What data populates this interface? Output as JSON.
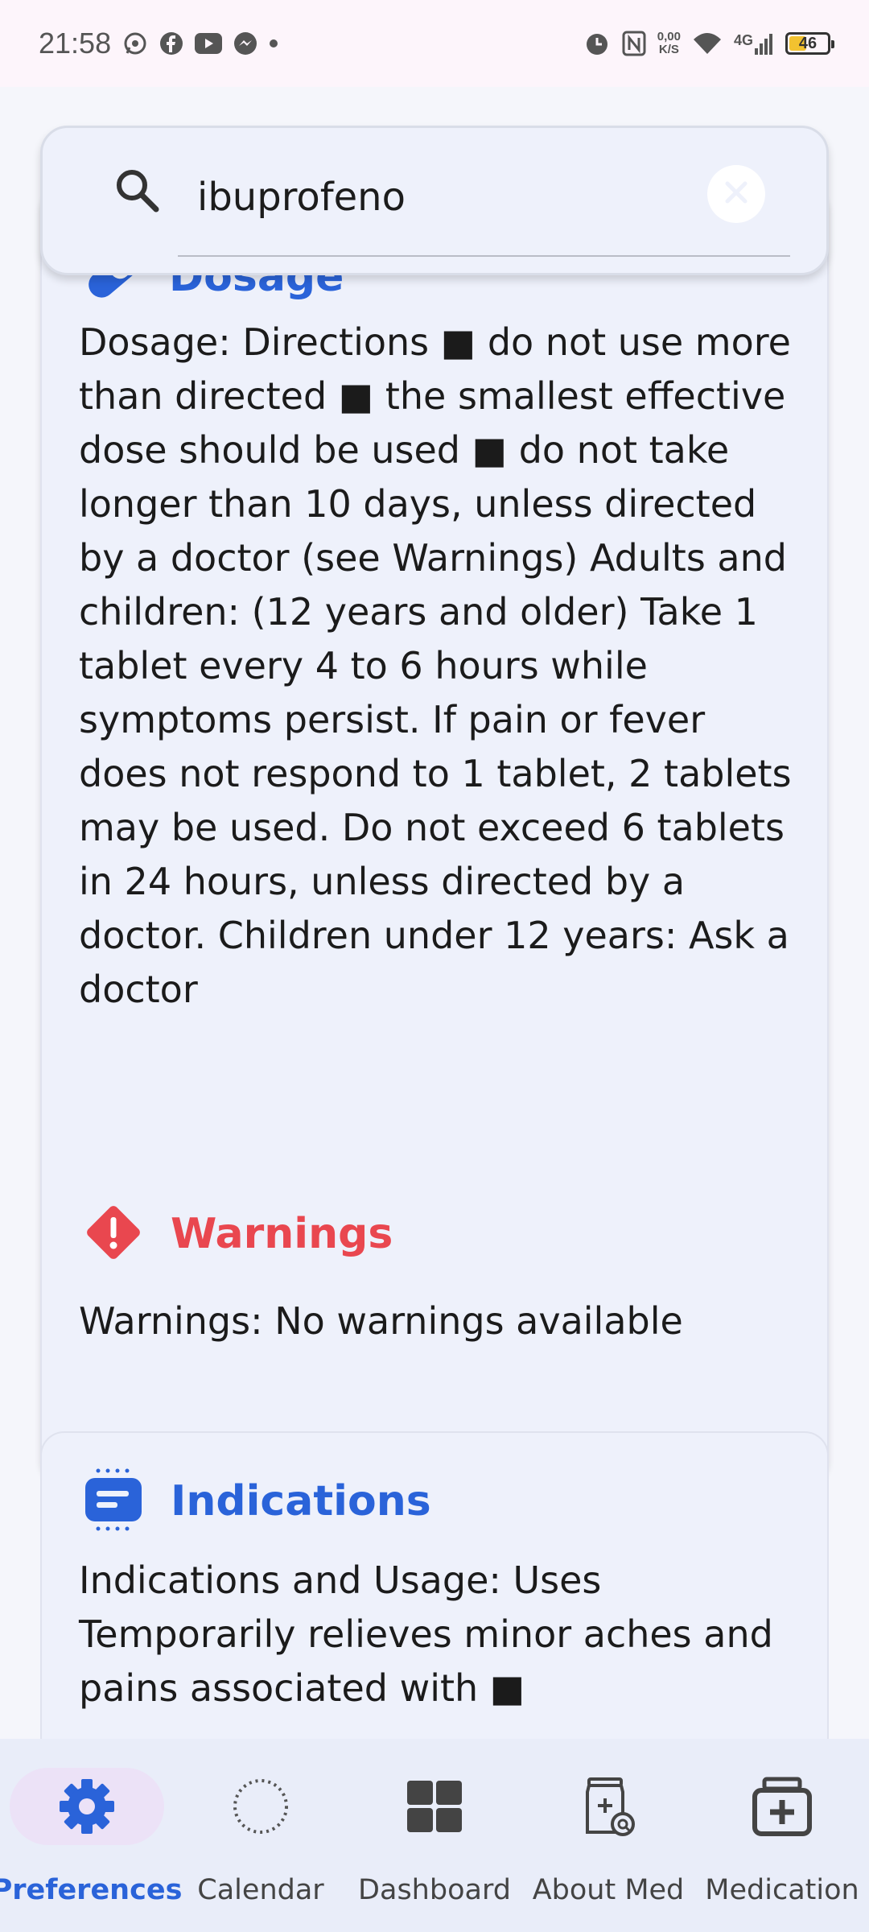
{
  "status_bar": {
    "time": "21:58",
    "net_speed_value": "0,00",
    "net_speed_unit": "K/S",
    "network": "4G",
    "battery": "46",
    "battery_level": 0.46
  },
  "search": {
    "value": "ibuprofeno",
    "placeholder": ""
  },
  "sections": {
    "dosage": {
      "title": "Dosage",
      "body": "Dosage: Directions ■ do not use more than directed ■ the smallest effective dose should be used ■ do not take longer than 10 days, unless directed by a doctor (see Warnings) Adults and children: (12 years and older) Take 1 tablet every 4 to 6 hours while symptoms persist. If pain or fever does not respond to 1 tablet, 2 tablets may be used. Do not exceed 6 tablets in 24 hours, unless directed by a doctor. Children under 12 years: Ask a doctor"
    },
    "warnings": {
      "title": "Warnings",
      "body": "Warnings: No warnings available"
    },
    "indications": {
      "title": "Indications",
      "body": "Indications and Usage: Uses Temporarily relieves minor aches and pains associated with ■"
    }
  },
  "nav": {
    "items": [
      {
        "label": "Preferences",
        "icon": "gear-icon",
        "active": true
      },
      {
        "label": "Calendar",
        "icon": "dotted-circle-icon",
        "active": false
      },
      {
        "label": "Dashboard",
        "icon": "dashboard-grid-icon",
        "active": false
      },
      {
        "label": "About Med",
        "icon": "medication-info-icon",
        "active": false
      },
      {
        "label": "Medication",
        "icon": "medical-box-icon",
        "active": false
      }
    ]
  },
  "colors": {
    "accent_blue": "#2a63d9",
    "warning_red": "#e9474f",
    "card_bg": "#eef1fb",
    "nav_bg": "#e9edf9",
    "active_pill": "#ece2f7"
  }
}
